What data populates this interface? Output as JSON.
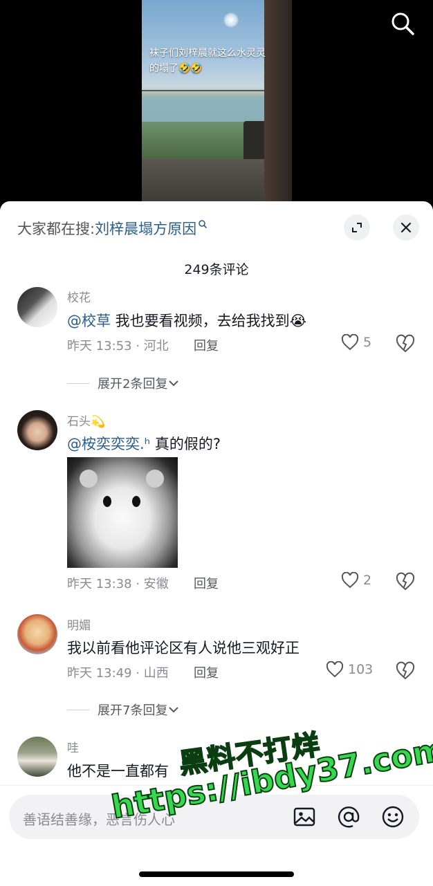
{
  "video": {
    "caption": "袜子们刘梓晨就这么水灵灵的塌了🤣🤣"
  },
  "header": {
    "hot_search_prefix": "大家都在搜:",
    "hot_search_keyword": "刘梓晨塌方原因",
    "comment_count": "249条评论"
  },
  "comments": [
    {
      "username": "校花",
      "mention": "@校草",
      "text": " 我也要看视频，去给我找到😭",
      "time_location": "昨天 13:53 · 河北",
      "reply_label": "回复",
      "likes": "5",
      "expand_label": "展开2条回复"
    },
    {
      "username": "石头💫",
      "mention": "@桉奕奕奕.ʰ",
      "text": " 真的假的?",
      "time_location": "昨天 13:38 · 安徽",
      "reply_label": "回复",
      "likes": "2"
    },
    {
      "username": "明媚",
      "text": "我以前看他评论区有人说他三观好正",
      "time_location": "昨天 13:49 · 山西",
      "reply_label": "回复",
      "likes": "103",
      "expand_label": "展开7条回复"
    },
    {
      "username": "哇",
      "text": "他不是一直都有"
    }
  ],
  "input": {
    "placeholder": "善语结善缘，恶言伤人心"
  },
  "watermark": {
    "line1": "黑料不打烊",
    "line2": "https://ibdy37.com"
  }
}
